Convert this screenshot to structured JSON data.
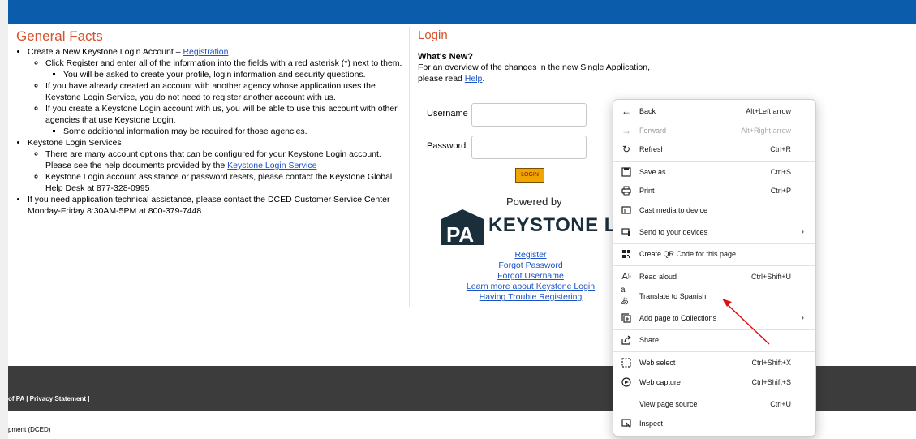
{
  "general": {
    "title": "General Facts",
    "b1_text": "Create a New Keystone Login Account – ",
    "b1_link": "Registration",
    "b1_s1": "Click Register and enter all of the information into the fields with a red asterisk (*) next to them.",
    "b1_s1_sub": "You will be asked to create your profile, login information and security questions.",
    "b1_s2_pre": "If you have already created an account with another agency whose application uses the Keystone Login Service, you ",
    "b1_s2_u": "do not",
    "b1_s2_post": " need to register another account with us.",
    "b1_s3": "If you create a Keystone Login account with us, you will be able to use this account with other agencies that use Keystone Login.",
    "b1_s3_sub": "Some additional information may be required for those agencies.",
    "b2_text": "Keystone Login Services",
    "b2_s1_pre": "There are many account options that can be configured for your Keystone Login account. Please see the help documents provided by the ",
    "b2_s1_link": "Keystone Login Service",
    "b2_s2": "Keystone Login account assistance or password resets, please contact the Keystone Global Help Desk at 877-328-0995",
    "b3_text": "If you need application technical assistance, please contact the DCED Customer Service Center Monday-Friday 8:30AM-5PM at 800-379-7448"
  },
  "login": {
    "title": "Login",
    "whats_new": "What's New?",
    "overview": "For an overview of the changes in the new Single Application,",
    "please_read": "please read ",
    "help_link": "Help",
    "period": ".",
    "username_label": "Username",
    "password_label": "Password",
    "login_button": "LOGIN",
    "powered_by": "Powered by",
    "logo_letters": "PA",
    "logo_text": "KEYSTONE LOGIN",
    "links": [
      "Register",
      "Forgot Password",
      "Forgot Username",
      "Learn more about Keystone Login",
      "Having Trouble Registering"
    ]
  },
  "footer": {
    "links_text": "of PA  |  Privacy Statement  |",
    "dept_text": "pment (DCED)"
  },
  "context_menu": {
    "items": [
      {
        "label": "Back",
        "shortcut": "Alt+Left arrow",
        "icon": "back-arrow-icon"
      },
      {
        "label": "Forward",
        "shortcut": "Alt+Right arrow",
        "icon": "forward-arrow-icon"
      },
      {
        "label": "Refresh",
        "shortcut": "Ctrl+R",
        "icon": "refresh-icon"
      },
      {
        "label": "Save as",
        "shortcut": "Ctrl+S",
        "icon": "save-as-icon"
      },
      {
        "label": "Print",
        "shortcut": "Ctrl+P",
        "icon": "print-icon"
      },
      {
        "label": "Cast media to device",
        "shortcut": "",
        "icon": "cast-icon"
      },
      {
        "label": "Send to your devices",
        "shortcut": "",
        "icon": "send-devices-icon"
      },
      {
        "label": "Create QR Code for this page",
        "shortcut": "",
        "icon": "qr-code-icon"
      },
      {
        "label": "Read aloud",
        "shortcut": "Ctrl+Shift+U",
        "icon": "read-aloud-icon"
      },
      {
        "label": "Translate to Spanish",
        "shortcut": "",
        "icon": "translate-icon"
      },
      {
        "label": "Add page to Collections",
        "shortcut": "",
        "icon": "collections-icon"
      },
      {
        "label": "Share",
        "shortcut": "",
        "icon": "share-icon"
      },
      {
        "label": "Web select",
        "shortcut": "Ctrl+Shift+X",
        "icon": "web-select-icon"
      },
      {
        "label": "Web capture",
        "shortcut": "Ctrl+Shift+S",
        "icon": "web-capture-icon"
      },
      {
        "label": "View page source",
        "shortcut": "Ctrl+U",
        "icon": ""
      },
      {
        "label": "Inspect",
        "shortcut": "",
        "icon": "inspect-icon"
      }
    ]
  },
  "colors": {
    "header_blue": "#0b5cab",
    "heading_orange": "#d4512b",
    "annotation_red": "#e01010"
  }
}
